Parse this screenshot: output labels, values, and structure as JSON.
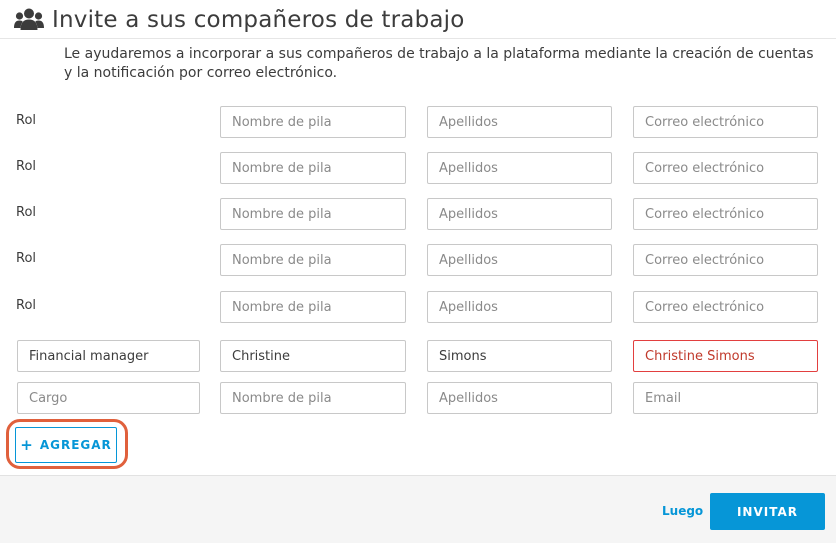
{
  "header": {
    "title": "Invite a sus compañeros de trabajo",
    "icon": "users-icon"
  },
  "description": {
    "line1": "Le ayudaremos a incorporar a sus compañeros de trabajo a la plataforma mediante la creación de cuentas",
    "line2": "y la notificación por correo electrónico."
  },
  "rows": [
    {
      "role_label": "Rol",
      "first_name_placeholder": "Nombre de pila",
      "last_name_placeholder": "Apellidos",
      "email_placeholder": "Correo electrónico"
    },
    {
      "role_label": "Rol",
      "first_name_placeholder": "Nombre de pila",
      "last_name_placeholder": "Apellidos",
      "email_placeholder": "Correo electrónico"
    },
    {
      "role_label": "Rol",
      "first_name_placeholder": "Nombre de pila",
      "last_name_placeholder": "Apellidos",
      "email_placeholder": "Correo electrónico"
    },
    {
      "role_label": "Rol",
      "first_name_placeholder": "Nombre de pila",
      "last_name_placeholder": "Apellidos",
      "email_placeholder": "Correo electrónico"
    },
    {
      "role_label": "Rol",
      "first_name_placeholder": "Nombre de pila",
      "last_name_placeholder": "Apellidos",
      "email_placeholder": "Correo electrónico"
    }
  ],
  "filled_row": {
    "role_value": "Financial manager",
    "first_name_value": "Christine",
    "last_name_value": "Simons",
    "email_value": "Christine Simons"
  },
  "new_row": {
    "role_placeholder": "Cargo",
    "first_name_placeholder": "Nombre de pila",
    "last_name_placeholder": "Apellidos",
    "email_placeholder": "Email"
  },
  "actions": {
    "add_label": "AGREGAR",
    "add_icon": "plus-icon",
    "later_label": "Luego",
    "invite_label": "INVITAR"
  },
  "colors": {
    "accent": "#0696d7",
    "error": "#e23f3f",
    "highlight": "#e0603c"
  }
}
